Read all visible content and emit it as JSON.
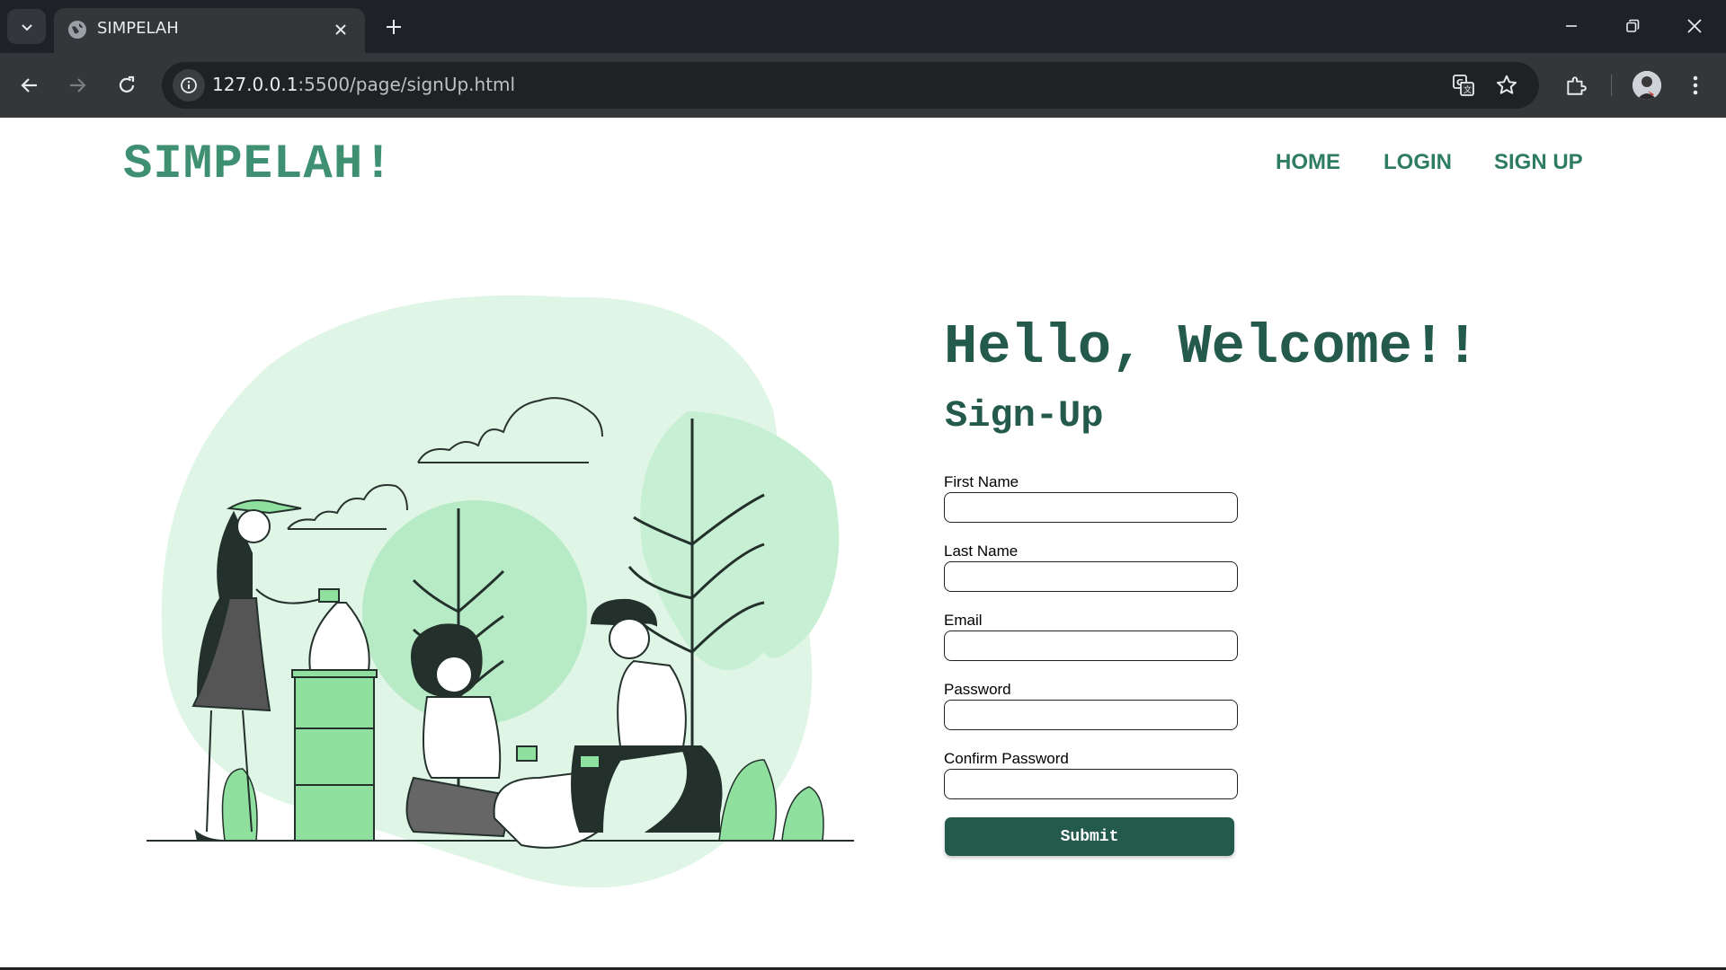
{
  "browser": {
    "tab_title": "SIMPELAH",
    "url_host": "127.0.0.1",
    "url_path": ":5500/page/signUp.html"
  },
  "site": {
    "logo": "SIMPELAH!",
    "nav": {
      "home": "HOME",
      "login": "LOGIN",
      "signup": "SIGN UP"
    }
  },
  "main": {
    "heading": "Hello, Welcome!!",
    "subheading": "Sign-Up",
    "form": {
      "fields": [
        {
          "label": "First Name",
          "value": ""
        },
        {
          "label": "Last Name",
          "value": ""
        },
        {
          "label": "Email",
          "value": ""
        },
        {
          "label": "Password",
          "value": ""
        },
        {
          "label": "Confirm Password",
          "value": ""
        }
      ],
      "submit_label": "Submit"
    }
  },
  "colors": {
    "brand": "#3f8f72",
    "heading": "#235a4c",
    "button": "#235a4c",
    "illustration_light": "#dff5e5",
    "illustration_mid": "#bfeccc",
    "illustration_accent": "#8fdf9f"
  },
  "icons": [
    "tab-list-icon",
    "globe-icon",
    "close-icon",
    "plus-icon",
    "minimize-icon",
    "restore-icon",
    "back-icon",
    "forward-icon",
    "reload-icon",
    "info-icon",
    "translate-icon",
    "star-icon",
    "extensions-icon",
    "more-icon"
  ]
}
